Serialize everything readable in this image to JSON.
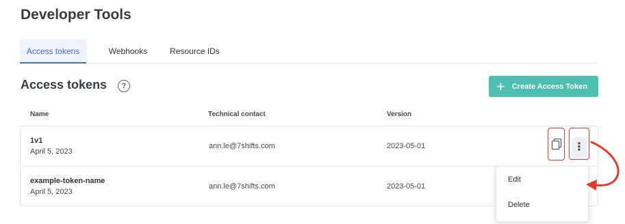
{
  "page": {
    "title": "Developer Tools"
  },
  "tabs": [
    {
      "label": "Access tokens",
      "active": true
    },
    {
      "label": "Webhooks",
      "active": false
    },
    {
      "label": "Resource IDs",
      "active": false
    }
  ],
  "section": {
    "title": "Access tokens",
    "help_icon": "?",
    "create_button": {
      "icon": "+",
      "label": "Create Access Token"
    }
  },
  "table": {
    "columns": [
      "Name",
      "Technical contact",
      "Version"
    ],
    "rows": [
      {
        "name": "1v1",
        "date": "April 5, 2023",
        "contact": "ann.le@7shifts.com",
        "version": "2023-05-01"
      },
      {
        "name": "example-token-name",
        "date": "April 5, 2023",
        "contact": "ann.le@7shifts.com",
        "version": "2023-05-01"
      }
    ]
  },
  "row_actions": {
    "copy_icon": "copy-icon",
    "more_icon": "⋮"
  },
  "dropdown": {
    "items": [
      "Edit",
      "Delete"
    ]
  },
  "colors": {
    "accent_blue": "#3f6fcc",
    "primary_button": "#4dbfb0",
    "highlight_red": "#e23b2e"
  }
}
